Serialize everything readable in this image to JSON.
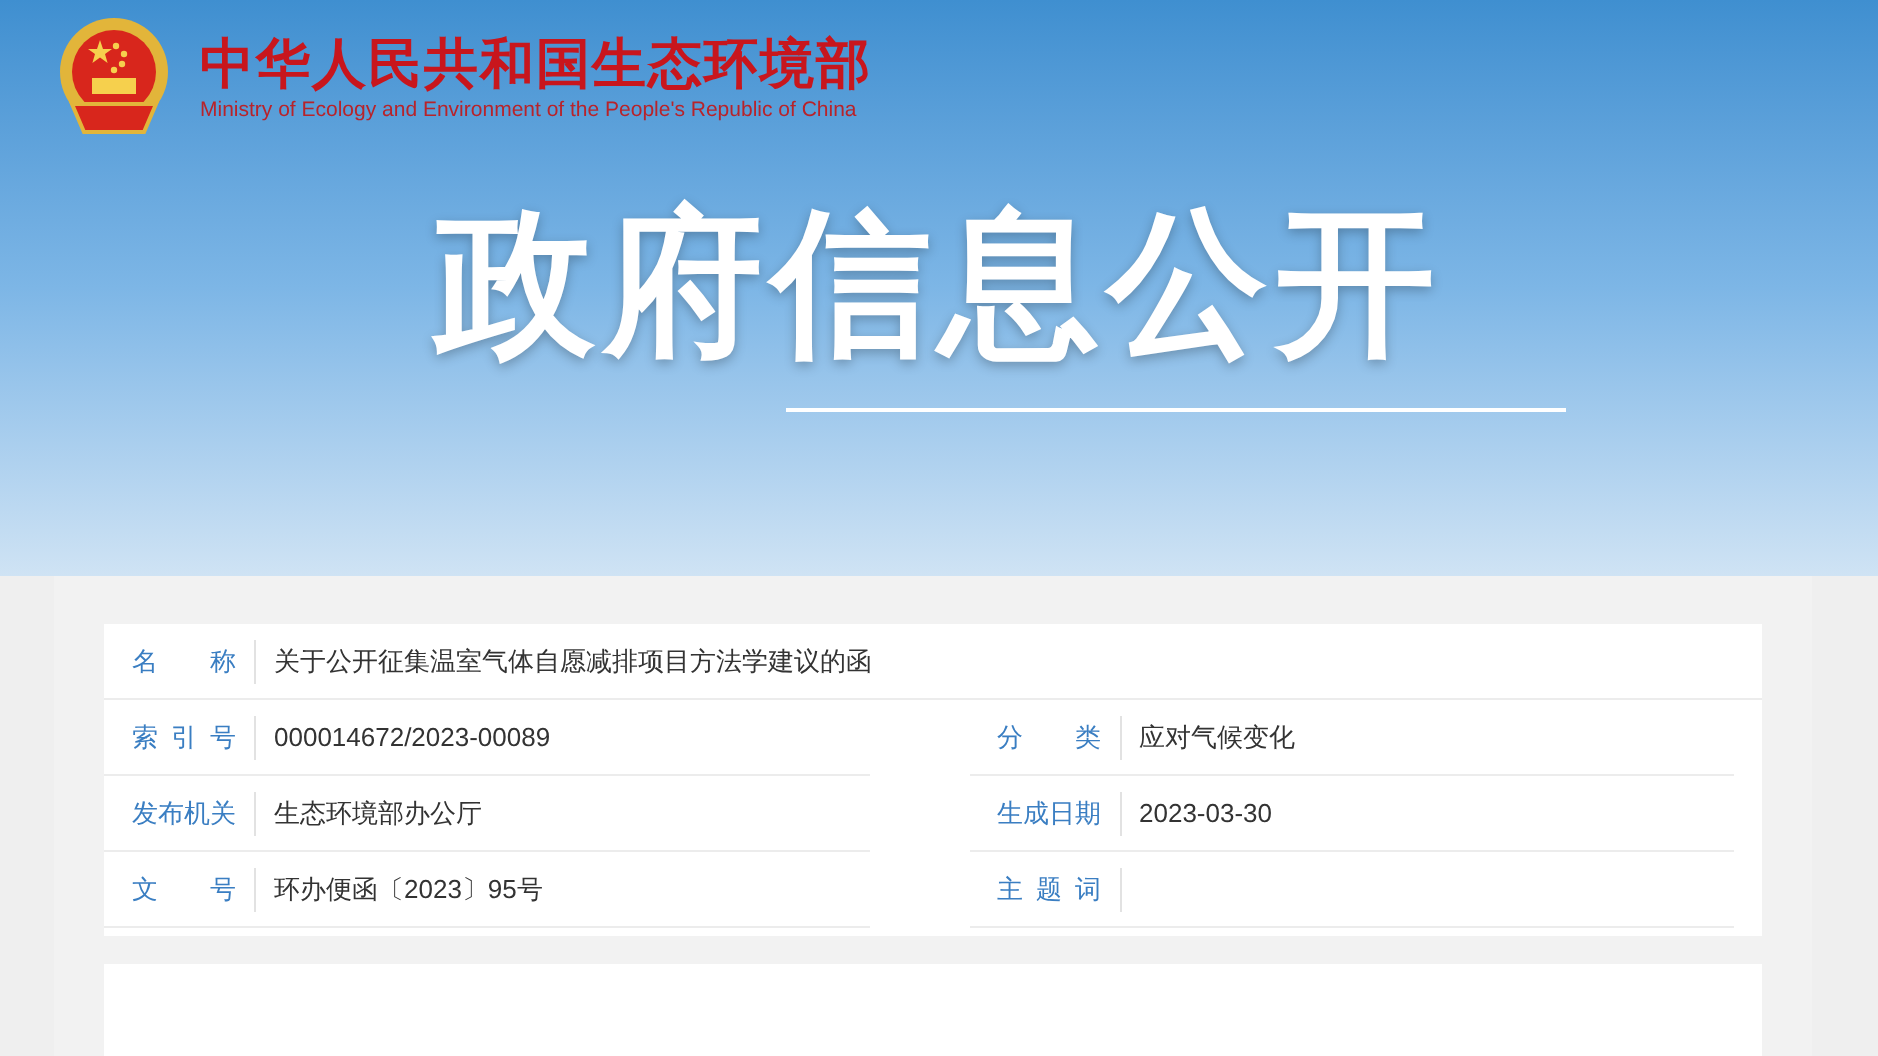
{
  "header": {
    "title": "中华人民共和国生态环境部",
    "subtitle": "Ministry of Ecology and Environment of the People's Republic of China"
  },
  "banner": {
    "title": "政府信息公开"
  },
  "info": {
    "full_rows": [
      {
        "label": "名称",
        "value": "关于公开征集温室气体自愿减排项目方法学建议的函"
      }
    ],
    "rows": [
      [
        {
          "label": "索引号",
          "value": "000014672/2023-00089"
        },
        {
          "label": "分类",
          "value": "应对气候变化"
        }
      ],
      [
        {
          "label": "发布机关",
          "value": "生态环境部办公厅"
        },
        {
          "label": "生成日期",
          "value": "2023-03-30"
        }
      ],
      [
        {
          "label": "文号",
          "value": "环办便函〔2023〕95号"
        },
        {
          "label": "主题词"
        }
      ]
    ]
  }
}
